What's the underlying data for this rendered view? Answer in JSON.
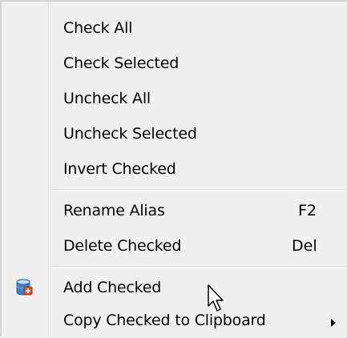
{
  "menu": {
    "items": [
      {
        "label": "Check All"
      },
      {
        "label": "Check Selected"
      },
      {
        "label": "Uncheck All"
      },
      {
        "label": "Uncheck Selected"
      },
      {
        "label": "Invert Checked"
      },
      {
        "label": "Rename Alias",
        "shortcut": "F2"
      },
      {
        "label": "Delete Checked",
        "shortcut": "Del"
      },
      {
        "label": "Add Checked",
        "icon": "add-database-icon"
      },
      {
        "label": "Copy Checked to Clipboard",
        "submenu": true
      }
    ]
  },
  "colors": {
    "menu_background": "#f0f0f0",
    "separator": "#e0e0e0",
    "text": "#000000"
  }
}
